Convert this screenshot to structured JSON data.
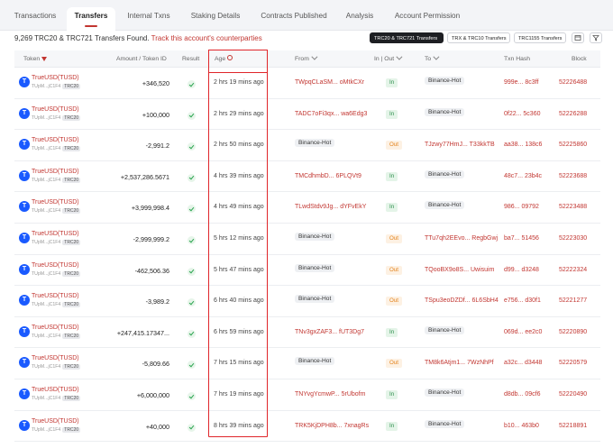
{
  "tabs": [
    "Transactions",
    "Transfers",
    "Internal Txns",
    "Staking Details",
    "Contracts Published",
    "Analysis",
    "Account Permission"
  ],
  "active_tab": "Transfers",
  "summary": {
    "count_text": "9,269 TRC20 & TRC721 Transfers Found.",
    "link_text": "Track this account's counterparties"
  },
  "filters": [
    "TRC20 & TRC721 Transfers",
    "TRX & TRC10 Transfers",
    "TRC1155 Transfers"
  ],
  "columns": {
    "token": "Token",
    "amount": "Amount / Token ID",
    "result": "Result",
    "age": "Age",
    "from": "From",
    "inout": "In | Out",
    "to": "To",
    "hash": "Txn Hash",
    "block": "Block"
  },
  "token": {
    "name": "TrueUSD(TUSD)",
    "address": "TUpM...jC1F4",
    "standard": "TRC20"
  },
  "labels": {
    "in": "In",
    "out": "Out",
    "hot": "Binance-Hot"
  },
  "rows": [
    {
      "amount": "+346,520",
      "age": "2 hrs 19 mins ago",
      "from": "TWpqCLaSM... oMtkCXr",
      "from_hot": false,
      "dir": "in",
      "to": "Binance-Hot",
      "to_hot": true,
      "hash": "999e... 8c3ff",
      "block": "52226488"
    },
    {
      "amount": "+100,000",
      "age": "2 hrs 29 mins ago",
      "from": "TADC7oFi3qx... wa6Edg3",
      "from_hot": false,
      "dir": "in",
      "to": "Binance-Hot",
      "to_hot": true,
      "hash": "0f22... 5c360",
      "block": "52226288"
    },
    {
      "amount": "-2,991.2",
      "age": "2 hrs 50 mins ago",
      "from": "Binance-Hot",
      "from_hot": true,
      "dir": "out",
      "to": "TJzwy77HmJ... T33kkTB",
      "to_hot": false,
      "hash": "aa38... 138c6",
      "block": "52225860"
    },
    {
      "amount": "+2,537,286.5671",
      "age": "4 hrs 39 mins ago",
      "from": "TMCdhmbD... 6PLQVt9",
      "from_hot": false,
      "dir": "in",
      "to": "Binance-Hot",
      "to_hot": true,
      "hash": "48c7... 23b4c",
      "block": "52223688"
    },
    {
      "amount": "+3,999,998.4",
      "age": "4 hrs 49 mins ago",
      "from": "TLwdStdv9Jg... dYFvEkY",
      "from_hot": false,
      "dir": "in",
      "to": "Binance-Hot",
      "to_hot": true,
      "hash": "986... 09792",
      "block": "52223488"
    },
    {
      "amount": "-2,999,999.2",
      "age": "5 hrs 12 mins ago",
      "from": "Binance-Hot",
      "from_hot": true,
      "dir": "out",
      "to": "TTu7qh2EEvo... RegbGwj",
      "to_hot": false,
      "hash": "ba7... 51456",
      "block": "52223030"
    },
    {
      "amount": "-462,506.36",
      "age": "5 hrs 47 mins ago",
      "from": "Binance-Hot",
      "from_hot": true,
      "dir": "out",
      "to": "TQooBX9o8S... Uwisuim",
      "to_hot": false,
      "hash": "d99... d3248",
      "block": "52222324"
    },
    {
      "amount": "-3,989.2",
      "age": "6 hrs 40 mins ago",
      "from": "Binance-Hot",
      "from_hot": true,
      "dir": "out",
      "to": "TSpu3eoDZDf... 6L6SbH4",
      "to_hot": false,
      "hash": "e756... d30f1",
      "block": "52221277"
    },
    {
      "amount": "+247,415.17347...",
      "age": "6 hrs 59 mins ago",
      "from": "TNv3gxZAF3... fUT3Dg7",
      "from_hot": false,
      "dir": "in",
      "to": "Binance-Hot",
      "to_hot": true,
      "hash": "069d... ee2c0",
      "block": "52220890"
    },
    {
      "amount": "-5,809.66",
      "age": "7 hrs 15 mins ago",
      "from": "Binance-Hot",
      "from_hot": true,
      "dir": "out",
      "to": "TM8k6Atjm1... 7WzNhPf",
      "to_hot": false,
      "hash": "a32c... d3448",
      "block": "52220579"
    },
    {
      "amount": "+6,000,000",
      "age": "7 hrs 19 mins ago",
      "from": "TNYvgYcmwP... 5rUbofm",
      "from_hot": false,
      "dir": "in",
      "to": "Binance-Hot",
      "to_hot": true,
      "hash": "d8db... 09cf6",
      "block": "52220490"
    },
    {
      "amount": "+40,000",
      "age": "8 hrs 39 mins ago",
      "from": "TRK5KjDPH8b... 7xnagRs",
      "from_hot": false,
      "dir": "in",
      "to": "Binance-Hot",
      "to_hot": true,
      "hash": "b10... 463b0",
      "block": "52218891"
    }
  ]
}
